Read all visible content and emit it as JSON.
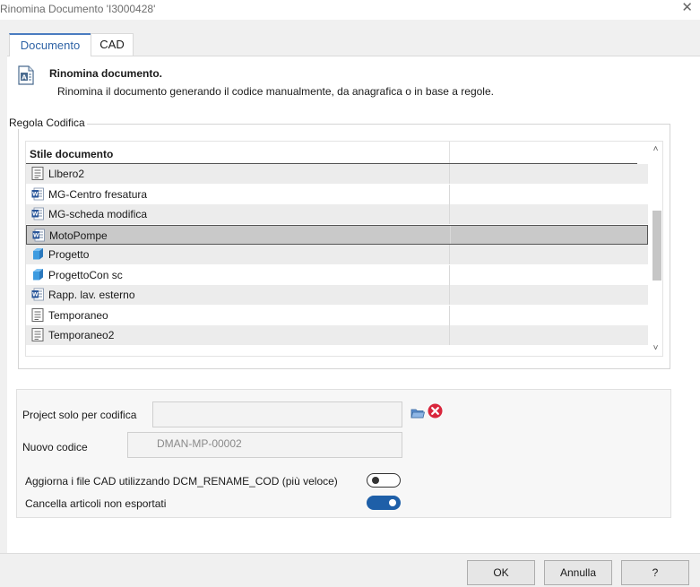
{
  "window": {
    "title": "Rinomina Documento 'I3000428'",
    "close_glyph": "✕"
  },
  "tabs": [
    {
      "label": "Documento",
      "active": true
    },
    {
      "label": "CAD",
      "active": false
    }
  ],
  "header": {
    "icon": "word-document-icon",
    "title": "Rinomina documento.",
    "subtitle": "Rinomina il documento generando il codice manualmente, da anagrafica o in base a regole."
  },
  "group": {
    "legend": "Regola Codifica"
  },
  "grid": {
    "column_header": "Stile documento",
    "rows": [
      {
        "label": "Llbero2",
        "icon": "document-lines-icon",
        "selected": false
      },
      {
        "label": "MG-Centro fresatura",
        "icon": "word-icon",
        "selected": false
      },
      {
        "label": "MG-scheda modifica",
        "icon": "word-icon",
        "selected": false
      },
      {
        "label": "MotoPompe",
        "icon": "word-icon",
        "selected": true
      },
      {
        "label": "Progetto",
        "icon": "cube-icon",
        "selected": false
      },
      {
        "label": "ProgettoCon sc",
        "icon": "cube-icon",
        "selected": false
      },
      {
        "label": "Rapp. lav. esterno",
        "icon": "word-icon",
        "selected": false
      },
      {
        "label": "Temporaneo",
        "icon": "document-lines-icon",
        "selected": false
      },
      {
        "label": "Temporaneo2",
        "icon": "document-lines-icon",
        "selected": false
      }
    ],
    "scroll_up_glyph": "˄",
    "scroll_down_glyph": "˅"
  },
  "form": {
    "project_label": "Project solo per codifica",
    "project_value": "",
    "nuovo_codice_label": "Nuovo codice",
    "nuovo_codice_value": "DMAN-MP-00002",
    "aggiorna_label": "Aggiorna i file CAD utilizzando DCM_RENAME_COD (più veloce)",
    "aggiorna_on": false,
    "cancella_label": "Cancella articoli non esportati",
    "cancella_on": true
  },
  "buttons": {
    "ok": "OK",
    "cancel": "Annulla",
    "help": "?"
  },
  "colors": {
    "accent": "#1e5fa8",
    "tab_active": "#2f63a6",
    "error_red": "#d9263c",
    "word_blue": "#2b579a",
    "cube_blue": "#3d9be0"
  }
}
